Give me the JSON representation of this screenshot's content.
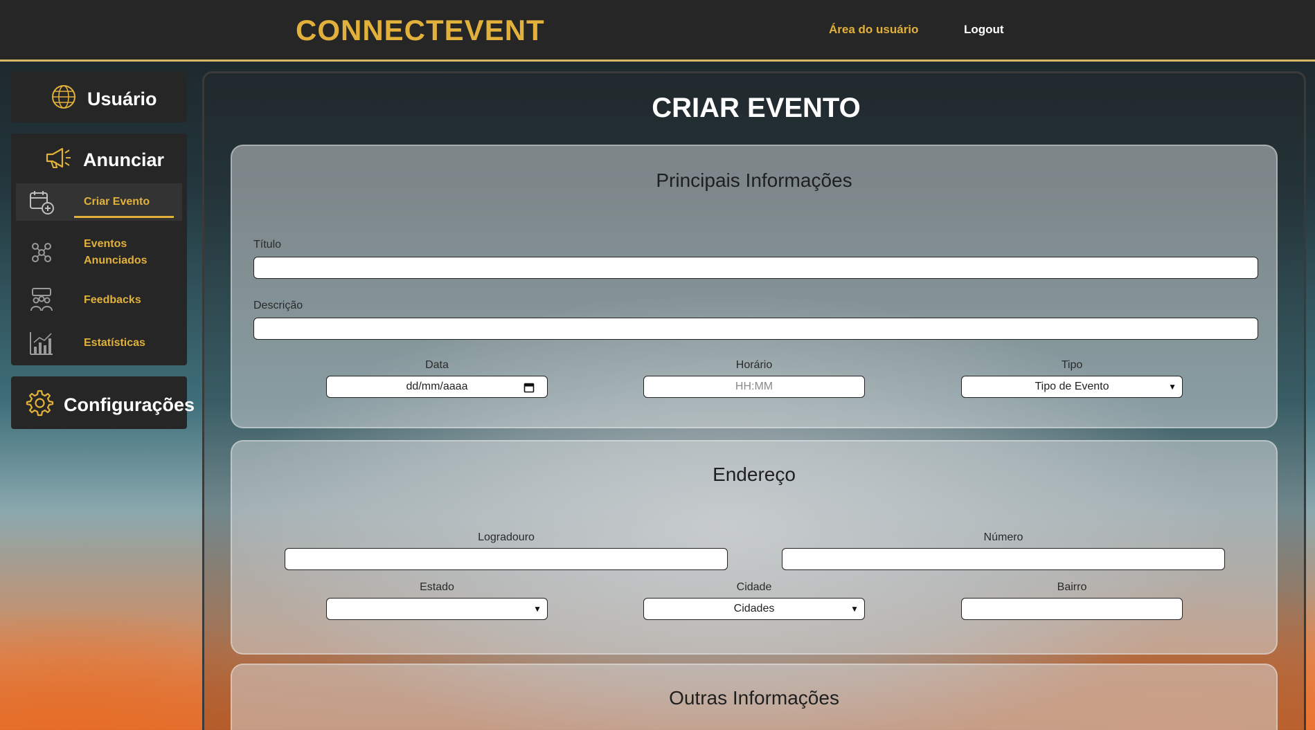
{
  "header": {
    "logo": "CONNECTEVENT",
    "nav_user_area": "Área do usuário",
    "nav_logout": "Logout"
  },
  "sidebar": {
    "usuario": {
      "label": "Usuário",
      "icon": "globe-icon"
    },
    "anunciar": {
      "label": "Anunciar",
      "icon": "megaphone-icon",
      "items": [
        {
          "label": "Criar Evento",
          "icon": "calendar-add-icon",
          "active": true
        },
        {
          "label": "Eventos Anunciados",
          "icon": "people-network-icon"
        },
        {
          "label": "Feedbacks",
          "icon": "group-feedback-icon"
        },
        {
          "label": "Estatísticas",
          "icon": "bar-chart-icon"
        }
      ]
    },
    "configuracoes": {
      "label": "Configurações",
      "icon": "gear-icon"
    }
  },
  "main": {
    "title": "CRIAR EVENTO",
    "principais": {
      "title": "Principais Informações",
      "titulo_label": "Título",
      "titulo_value": "",
      "descricao_label": "Descrição",
      "descricao_value": "",
      "data_label": "Data",
      "data_placeholder": "dd/mm/aaaa",
      "horario_label": "Horário",
      "horario_placeholder": "HH:MM",
      "tipo_label": "Tipo",
      "tipo_selected": "Tipo de Evento"
    },
    "endereco": {
      "title": "Endereço",
      "logradouro_label": "Logradouro",
      "numero_label": "Número",
      "estado_label": "Estado",
      "estado_selected": "",
      "cidade_label": "Cidade",
      "cidade_selected": "Cidades",
      "bairro_label": "Bairro"
    },
    "outras": {
      "title": "Outras Informações"
    }
  },
  "colors": {
    "accent": "#e2b13c",
    "header_bg": "#262626",
    "sidebar_bg": "#262626"
  }
}
